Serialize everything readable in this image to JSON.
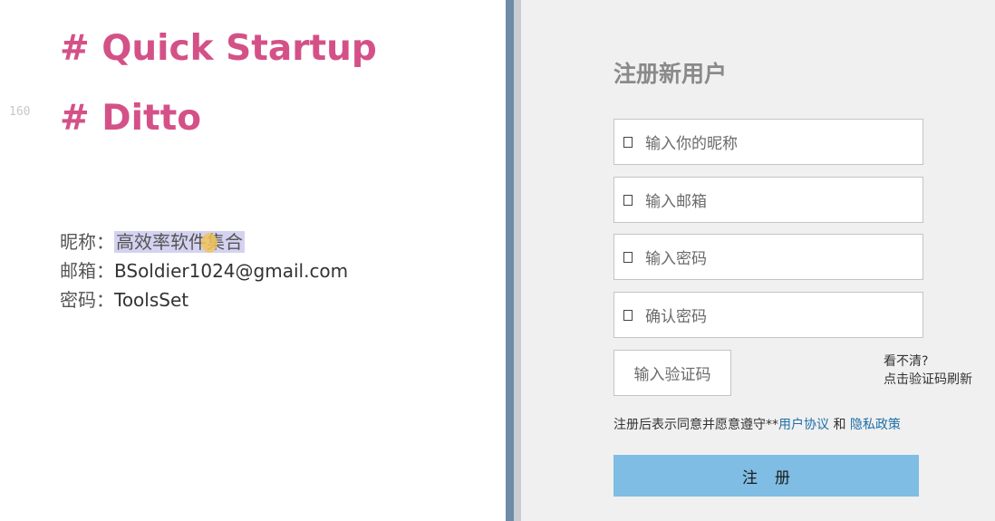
{
  "editor": {
    "line_number": "160",
    "heading_1": "# Quick Startup",
    "heading_2": "# Ditto",
    "fields": [
      {
        "label": "昵称：",
        "value": "高效率软件集合"
      },
      {
        "label": "邮箱：",
        "value": "BSoldier1024@gmail.com"
      },
      {
        "label": "密码：",
        "value": "ToolsSet"
      }
    ]
  },
  "form": {
    "title": "注册新用户",
    "inputs": [
      {
        "placeholder": "输入你的昵称",
        "icon": "user-icon"
      },
      {
        "placeholder": "输入邮箱",
        "icon": "mail-icon"
      },
      {
        "placeholder": "输入密码",
        "icon": "lock-icon"
      },
      {
        "placeholder": "确认密码",
        "icon": "lock-icon"
      }
    ],
    "captcha_placeholder": "输入验证码",
    "captcha_help_line1": "看不清?",
    "captcha_help_line2": "点击验证码刷新",
    "agreement_prefix": "注册后表示同意并愿意遵守**",
    "agreement_link1": "用户协议",
    "agreement_and": " 和 ",
    "agreement_link2": "隐私政策",
    "submit_label": "注    册"
  },
  "colors": {
    "heading_pink": "#d45188",
    "selection_highlight": "#d4d2f0",
    "link_blue": "#1f6fa8",
    "button_blue": "#7fbde4",
    "divider": "#6e8ba6"
  }
}
